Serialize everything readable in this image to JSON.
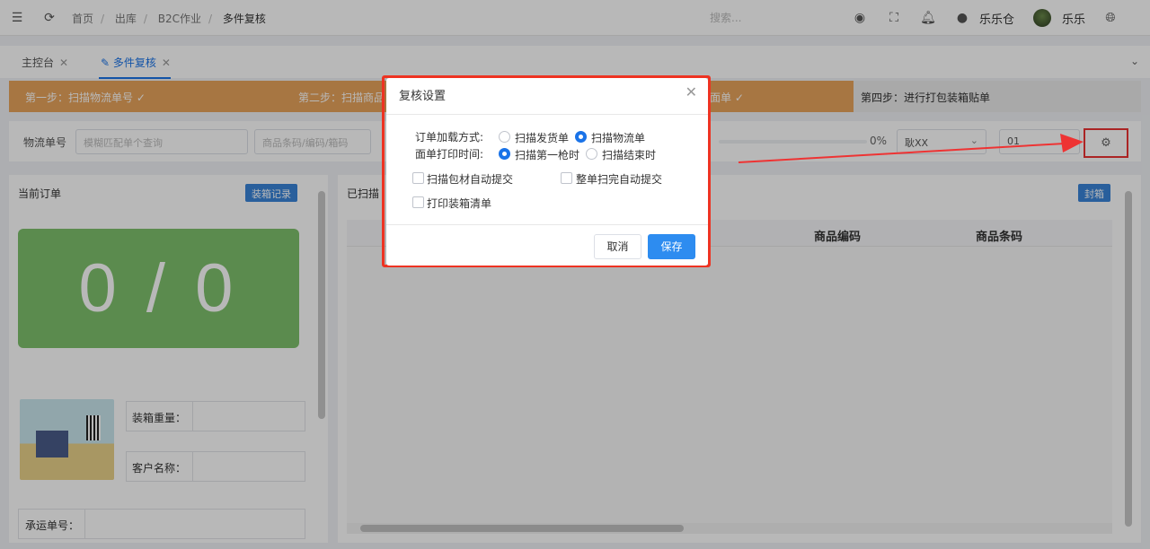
{
  "header": {
    "breadcrumb": [
      "首页",
      "出库",
      "B2C作业",
      "多件复核"
    ],
    "search_placeholder": "搜索...",
    "store_name": "乐乐仓",
    "user_name": "乐乐"
  },
  "tabs": [
    {
      "label": "主控台"
    },
    {
      "label": "多件复核"
    }
  ],
  "steps": {
    "step1": "第一步：扫描物流单号 ✓",
    "step2": "第二步：扫描商品",
    "step3": "面单 ✓",
    "step4": "第四步：进行打包装箱贴单"
  },
  "filter": {
    "label": "物流单号",
    "logistics_placeholder": "模糊匹配单个查询",
    "sku_placeholder": "商品条码/编码/箱码",
    "progress_percent": "0%",
    "progress_value": 0,
    "select_value": "耿XX",
    "station_value": "01"
  },
  "left_panel": {
    "title": "当前订单",
    "record_button": "装箱记录",
    "counter": "0 / 0",
    "weight_label": "装箱重量：",
    "customer_label": "客户名称：",
    "carrier_label": "承运单号："
  },
  "right_panel": {
    "title": "已扫描",
    "seal_button": "封箱",
    "columns": [
      "商品编码",
      "商品条码"
    ]
  },
  "modal": {
    "title": "复核设置",
    "load_mode_label": "订单加载方式:",
    "load_mode_options": [
      "扫描发货单",
      "扫描物流单"
    ],
    "load_mode_selected": 1,
    "print_time_label": "面单打印时间:",
    "print_time_options": [
      "扫描第一枪时",
      "扫描结束时"
    ],
    "print_time_selected": 0,
    "checkboxes": [
      "扫描包材自动提交",
      "整单扫完自动提交",
      "打印装箱清单"
    ],
    "cancel_label": "取消",
    "save_label": "保存"
  },
  "colors": {
    "accent": "#1a73e8",
    "steps_bg": "#e8a45c",
    "counter_bg": "#7fc16c",
    "highlight": "#e33333"
  },
  "icons": [
    "menu-icon",
    "refresh-icon",
    "record-icon",
    "fullscreen-icon",
    "bell-icon",
    "user-icon",
    "globe-icon",
    "edit-icon",
    "gear-icon",
    "chevron-down-icon",
    "close-icon"
  ]
}
